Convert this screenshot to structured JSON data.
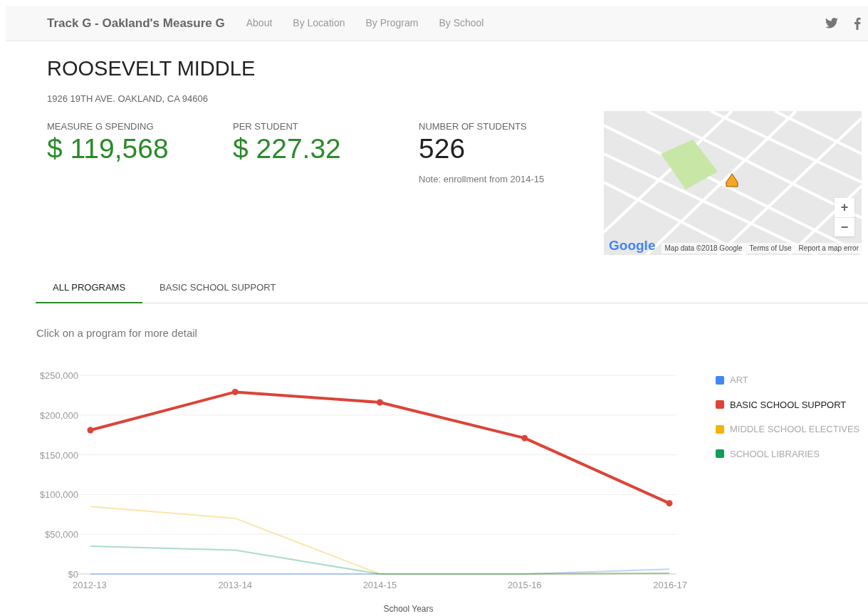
{
  "navbar": {
    "brand": "Track G - Oakland's Measure G",
    "links": [
      {
        "label": "About"
      },
      {
        "label": "By Location"
      },
      {
        "label": "By Program"
      },
      {
        "label": "By School"
      }
    ]
  },
  "school": {
    "name": "ROOSEVELT MIDDLE",
    "address": "1926 19TH AVE. OAKLAND, CA 94606"
  },
  "stats": [
    {
      "label": "MEASURE G SPENDING",
      "value": "$ 119,568",
      "kind": "money"
    },
    {
      "label": "PER STUDENT",
      "value": "$ 227.32",
      "kind": "money"
    },
    {
      "label": "NUMBER OF STUDENTS",
      "value": "526",
      "kind": "count",
      "note": "Note: enrollment from 2014-15"
    }
  ],
  "map": {
    "zoom_in": "+",
    "zoom_out": "−",
    "logo": "Google",
    "attribution": "Map data ©2018 Google",
    "terms": "Terms of Use",
    "report": "Report a map error"
  },
  "tabs": [
    {
      "label": "ALL PROGRAMS",
      "selected": true
    },
    {
      "label": "BASIC SCHOOL SUPPORT",
      "selected": false
    }
  ],
  "hint": "Click on a program for more detail",
  "legend": [
    {
      "selected": false
    },
    {
      "selected": true
    },
    {
      "selected": false
    },
    {
      "selected": false
    }
  ],
  "chart_data": {
    "type": "line",
    "grid": true,
    "xlabel": "School Years",
    "categories": [
      "2012-13",
      "2013-14",
      "2014-15",
      "2015-16",
      "2016-17"
    ],
    "ylim": [
      0,
      250000
    ],
    "yticks": [
      {
        "value": 0,
        "label": "$0"
      },
      {
        "value": 50000,
        "label": "$50,000"
      },
      {
        "value": 100000,
        "label": "$100,000"
      },
      {
        "value": 150000,
        "label": "$150,000"
      },
      {
        "value": 200000,
        "label": "$200,000"
      },
      {
        "value": 250000,
        "label": "$250,000"
      }
    ],
    "series": [
      {
        "name": "ART",
        "color": "#4285f4",
        "values": [
          0,
          0,
          0,
          0,
          6000
        ]
      },
      {
        "name": "BASIC SCHOOL SUPPORT",
        "color": "#db4437",
        "marker": true,
        "values": [
          181000,
          229000,
          216000,
          171000,
          89000
        ]
      },
      {
        "name": "MIDDLE SCHOOL ELECTIVES",
        "color": "#f4b400",
        "values": [
          85000,
          70000,
          0,
          0,
          1000
        ]
      },
      {
        "name": "SCHOOL LIBRARIES",
        "color": "#0f9d58",
        "values": [
          35000,
          30000,
          0,
          0,
          1000
        ]
      }
    ]
  }
}
